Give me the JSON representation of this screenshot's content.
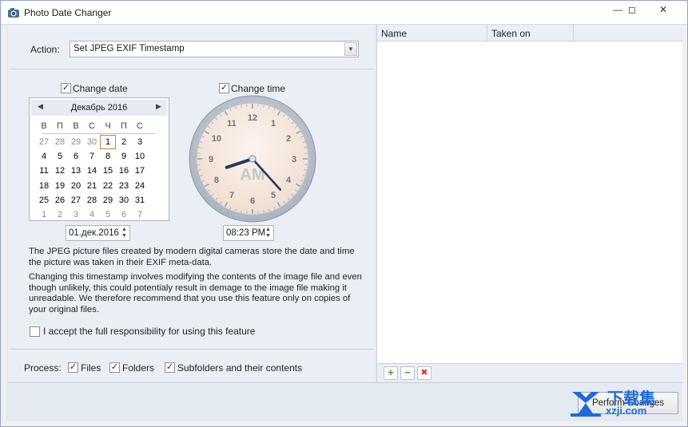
{
  "window": {
    "title": "Photo Date Changer",
    "controls": {
      "minimize": "—",
      "maximize": "◻",
      "close": "✕"
    }
  },
  "action": {
    "label": "Action:",
    "selected": "Set JPEG EXIF Timestamp"
  },
  "date": {
    "checkbox_label": "Change date",
    "checked": true,
    "calendar": {
      "month_title": "Декабрь 2016",
      "weekdays": [
        "В",
        "П",
        "В",
        "С",
        "Ч",
        "П",
        "С"
      ],
      "weeks": [
        [
          "27",
          "28",
          "29",
          "30",
          "1",
          "2",
          "3"
        ],
        [
          "4",
          "5",
          "6",
          "7",
          "8",
          "9",
          "10"
        ],
        [
          "11",
          "12",
          "13",
          "14",
          "15",
          "16",
          "17"
        ],
        [
          "18",
          "19",
          "20",
          "21",
          "22",
          "23",
          "24"
        ],
        [
          "25",
          "26",
          "27",
          "28",
          "29",
          "30",
          "31"
        ],
        [
          "1",
          "2",
          "3",
          "4",
          "5",
          "6",
          "7"
        ]
      ],
      "selected_day": "1"
    },
    "value": "01.дек.2016"
  },
  "time": {
    "checkbox_label": "Change time",
    "checked": true,
    "clock": {
      "numbers": [
        "12",
        "1",
        "2",
        "3",
        "4",
        "5",
        "6",
        "7",
        "8",
        "9",
        "10",
        "11"
      ],
      "meridiem": "AM",
      "hour": 8,
      "minute": 23
    },
    "value": "08:23 PM"
  },
  "info": {
    "paragraph1": "The JPEG picture files created by modern digital cameras store the date and time the picture was taken in their EXIF meta-data.",
    "paragraph2": "Changing this timestamp involves modifying the contents of the image file and even though unlikely, this could potentialy result in demage to the image file making it unreadable. We therefore recommend that you use this feature only on copies of your original files."
  },
  "accept": {
    "label": "I accept the full responsibility for using this feature",
    "checked": false
  },
  "process": {
    "label": "Process:",
    "options": [
      {
        "label": "Files",
        "checked": true
      },
      {
        "label": "Folders",
        "checked": true
      },
      {
        "label": "Subfolders and their contents",
        "checked": true
      }
    ]
  },
  "list": {
    "columns": [
      "Name",
      "Taken on"
    ],
    "toolbar": {
      "add": "+",
      "remove": "−",
      "delete": "✖"
    }
  },
  "perform_button": "Perform Changes",
  "watermark": {
    "big": "下载集",
    "small": "xzji.com"
  },
  "colors": {
    "add": "#3aa52a",
    "remove": "#3aa52a",
    "delete": "#d43b2a",
    "accent": "#1e6bd6"
  }
}
